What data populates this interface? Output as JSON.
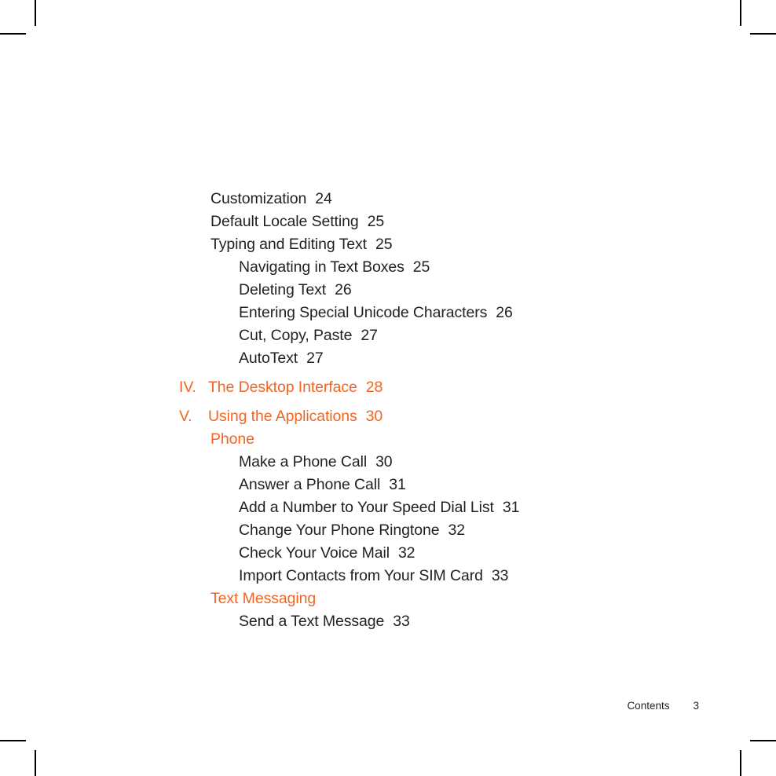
{
  "colors": {
    "accent": "#f26522",
    "body_text": "#231f20",
    "crop_mark": "#000000",
    "page_background": "#ffffff"
  },
  "page": {
    "kind": "table-of-contents",
    "crop_marks": [
      "top-left",
      "top-right",
      "bottom-left",
      "bottom-right"
    ]
  },
  "toc": {
    "entries": [
      {
        "level": 1,
        "roman": "",
        "label": "Customization",
        "page": "24",
        "accent": false
      },
      {
        "level": 1,
        "roman": "",
        "label": "Default Locale Setting",
        "page": "25",
        "accent": false
      },
      {
        "level": 1,
        "roman": "",
        "label": "Typing and Editing Text",
        "page": "25",
        "accent": false
      },
      {
        "level": 2,
        "roman": "",
        "label": "Navigating in Text Boxes",
        "page": "25",
        "accent": false
      },
      {
        "level": 2,
        "roman": "",
        "label": "Deleting Text",
        "page": "26",
        "accent": false
      },
      {
        "level": 2,
        "roman": "",
        "label": "Entering Special Unicode Characters",
        "page": "26",
        "accent": false
      },
      {
        "level": 2,
        "roman": "",
        "label": "Cut, Copy, Paste",
        "page": "27",
        "accent": false
      },
      {
        "level": 2,
        "roman": "",
        "label": "AutoText",
        "page": "27",
        "accent": false
      },
      {
        "level": 0,
        "roman": "IV.",
        "label": "The Desktop Interface",
        "page": "28",
        "accent": true,
        "gap_before": true
      },
      {
        "level": 0,
        "roman": "V.",
        "label": "Using the Applications",
        "page": "30",
        "accent": true,
        "gap_before": true
      },
      {
        "level": 1,
        "roman": "",
        "label": "Phone",
        "page": "",
        "accent": true
      },
      {
        "level": 2,
        "roman": "",
        "label": "Make a Phone Call",
        "page": "30",
        "accent": false
      },
      {
        "level": 2,
        "roman": "",
        "label": "Answer a Phone Call",
        "page": "31",
        "accent": false
      },
      {
        "level": 2,
        "roman": "",
        "label": "Add a Number to Your Speed Dial List",
        "page": "31",
        "accent": false
      },
      {
        "level": 2,
        "roman": "",
        "label": "Change Your Phone Ringtone",
        "page": "32",
        "accent": false
      },
      {
        "level": 2,
        "roman": "",
        "label": "Check Your Voice Mail",
        "page": "32",
        "accent": false
      },
      {
        "level": 2,
        "roman": "",
        "label": "Import Contacts from Your SIM Card",
        "page": "33",
        "accent": false
      },
      {
        "level": 1,
        "roman": "",
        "label": "Text Messaging",
        "page": "",
        "accent": true
      },
      {
        "level": 2,
        "roman": "",
        "label": "Send a Text Message",
        "page": "33",
        "accent": false
      }
    ]
  },
  "footer": {
    "running_head": "Contents",
    "folio": "3"
  }
}
